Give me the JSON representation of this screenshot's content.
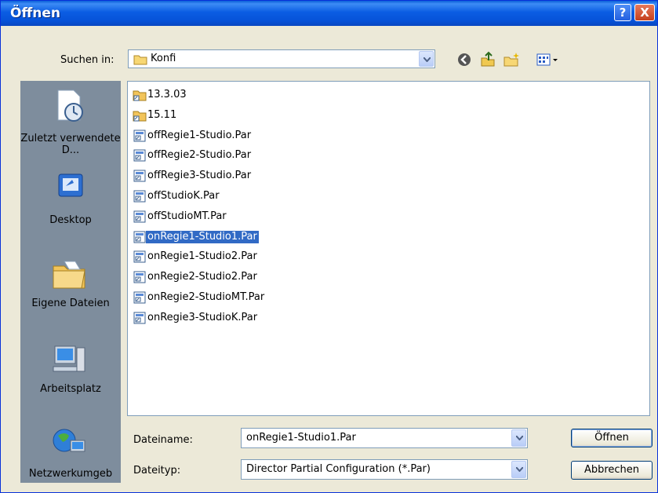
{
  "window": {
    "title": "Öffnen",
    "help_label": "?",
    "close_label": "X"
  },
  "toolbar": {
    "look_in_label": "Suchen in:",
    "look_in_value": "Konfi",
    "icons": [
      "back-icon",
      "up-folder-icon",
      "new-folder-icon",
      "views-menu-icon"
    ]
  },
  "places": [
    {
      "label": "Zuletzt verwendete D...",
      "icon": "recent-documents-icon"
    },
    {
      "label": "Desktop",
      "icon": "desktop-icon"
    },
    {
      "label": "Eigene Dateien",
      "icon": "my-documents-icon"
    },
    {
      "label": "Arbeitsplatz",
      "icon": "my-computer-icon"
    },
    {
      "label": "Netzwerkumgeb",
      "icon": "network-places-icon"
    }
  ],
  "files": [
    {
      "name": "13.3.03",
      "type": "folder"
    },
    {
      "name": "15.11",
      "type": "folder"
    },
    {
      "name": "offRegie1-Studio.Par",
      "type": "file"
    },
    {
      "name": "offRegie2-Studio.Par",
      "type": "file"
    },
    {
      "name": "offRegie3-Studio.Par",
      "type": "file"
    },
    {
      "name": "offStudioK.Par",
      "type": "file"
    },
    {
      "name": "offStudioMT.Par",
      "type": "file"
    },
    {
      "name": "onRegie1-Studio1.Par",
      "type": "file",
      "selected": true
    },
    {
      "name": "onRegie1-Studio2.Par",
      "type": "file"
    },
    {
      "name": "onRegie2-Studio2.Par",
      "type": "file"
    },
    {
      "name": "onRegie2-StudioMT.Par",
      "type": "file"
    },
    {
      "name": "onRegie3-StudioK.Par",
      "type": "file"
    }
  ],
  "form": {
    "filename_label": "Dateiname:",
    "filename_value": "onRegie1-Studio1.Par",
    "filetype_label": "Dateityp:",
    "filetype_value": "Director Partial Configuration (*.Par)"
  },
  "buttons": {
    "open": "Öffnen",
    "cancel": "Abbrechen"
  }
}
